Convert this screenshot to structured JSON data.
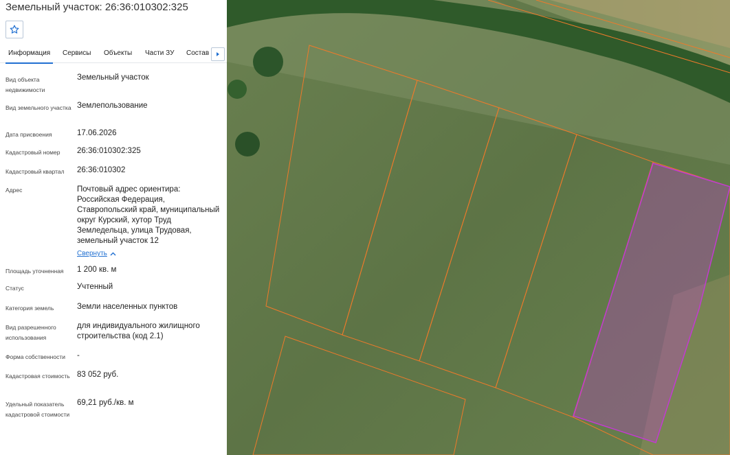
{
  "header": {
    "title": "Земельный участок: 26:36:010302:325"
  },
  "icons": {
    "favorite": "star-outline-icon",
    "tab_scroll": "caret-right-icon",
    "collapse": "chevron-up-icon"
  },
  "tabs": [
    {
      "label": "Информация",
      "active": true
    },
    {
      "label": "Сервисы",
      "active": false
    },
    {
      "label": "Объекты",
      "active": false
    },
    {
      "label": "Части ЗУ",
      "active": false
    },
    {
      "label": "Состав",
      "active": false
    }
  ],
  "fields": [
    {
      "label": "Вид объекта недвижимости",
      "value": "Земельный участок"
    },
    {
      "label": "Вид земельного участка",
      "value": "Землепользование"
    },
    {
      "label": "Дата присвоения",
      "value": "17.06.2026"
    },
    {
      "label": "Кадастровый номер",
      "value": "26:36:010302:325"
    },
    {
      "label": "Кадастровый квартал",
      "value": "26:36:010302"
    },
    {
      "label": "Адрес",
      "value": "Почтовый адрес ориентира: Российская Федерация, Ставропольский край, муниципальный округ Курский, хутор Труд Земледельца, улица Трудовая, земельный участок 12",
      "link": "Свернуть"
    },
    {
      "label": "Площадь уточненная",
      "value": "1 200 кв. м"
    },
    {
      "label": "Статус",
      "value": "Учтенный"
    },
    {
      "label": "Категория земель",
      "value": "Земли населенных пунктов"
    },
    {
      "label": "Вид разрешенного использования",
      "value": "для индивидуального жилищного строительства (код 2.1)"
    },
    {
      "label": "Форма собственности",
      "value": "-"
    },
    {
      "label": "Кадастровая стоимость",
      "value": "83 052 руб."
    },
    {
      "label": "Удельный показатель кадастровой стоимости",
      "value": "69,21 руб./кв. м"
    }
  ],
  "colors": {
    "accent": "#1f6fd1",
    "parcel_border": "#f07a2a",
    "selected_parcel": "#c23bd0",
    "field_green": "#5f7a45",
    "tree_green": "#2f5a2a",
    "road": "#8a8a5a"
  }
}
